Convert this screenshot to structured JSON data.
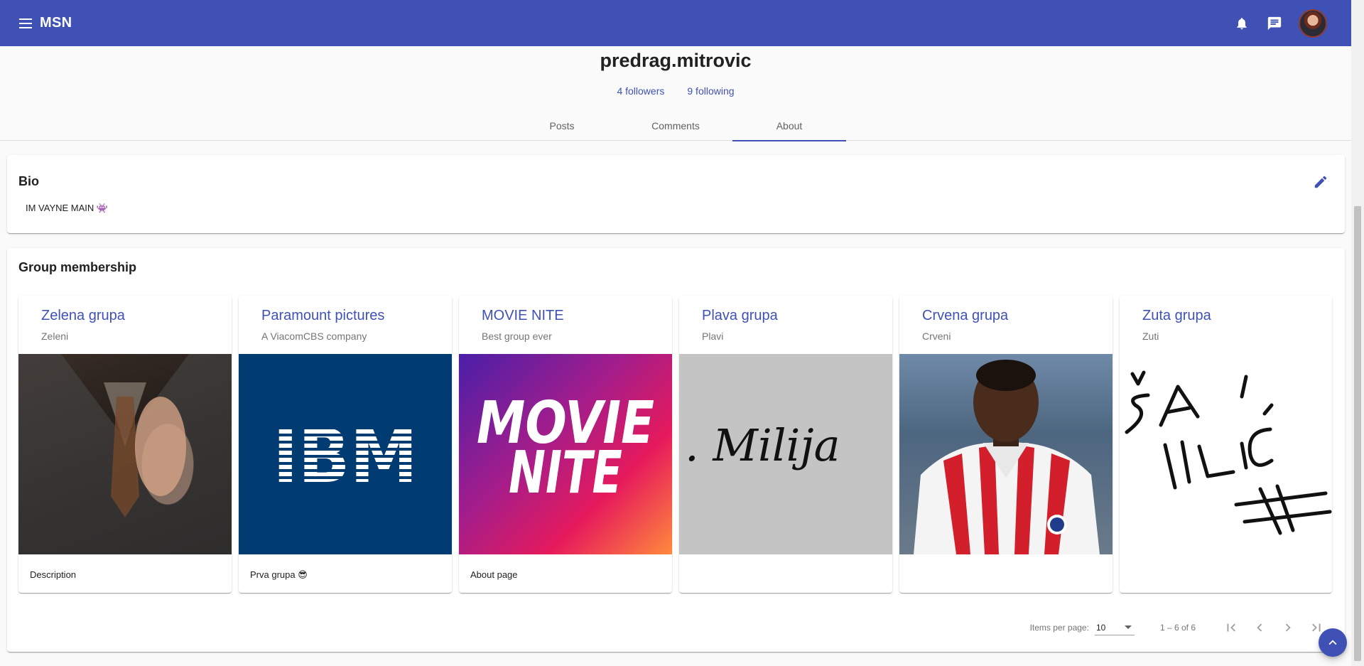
{
  "app": {
    "title": "MSN"
  },
  "toolbar": {
    "icons": [
      "menu-icon",
      "bell-icon",
      "chat-icon"
    ],
    "color": "#3f51b5"
  },
  "profile": {
    "username": "predrag.mitrovic",
    "followers": "4 followers",
    "following": "9 following"
  },
  "tabs": [
    {
      "label": "Posts"
    },
    {
      "label": "Comments"
    },
    {
      "label": "About",
      "active": true
    }
  ],
  "bio": {
    "title": "Bio",
    "text": "IM VAYNE MAIN 👾"
  },
  "groups": {
    "title": "Group membership",
    "items": [
      {
        "name": "Zelena grupa",
        "subtitle": "Zeleni",
        "description": "Description",
        "image": "suit-photo"
      },
      {
        "name": "Paramount pictures",
        "subtitle": "A ViacomCBS company",
        "description": "Prva grupa 😎",
        "image": "ibm-logo",
        "image_text": "IBM"
      },
      {
        "name": "MOVIE NITE",
        "subtitle": "Best group ever",
        "description": "About page",
        "image": "movie-nite-poster",
        "image_text": "MOVIE NITE"
      },
      {
        "name": "Plava grupa",
        "subtitle": "Plavi",
        "description": "",
        "image": "signature-image",
        "image_text": ". Milija"
      },
      {
        "name": "Crvena grupa",
        "subtitle": "Crveni",
        "description": "",
        "image": "football-player-photo"
      },
      {
        "name": "Zuta grupa",
        "subtitle": "Zuti",
        "description": "",
        "image": "handwriting-image",
        "image_text": "ŠA ILIĆ #"
      }
    ]
  },
  "paginator": {
    "items_per_page_label": "Items per page:",
    "items_per_page_value": "10",
    "range": "1 – 6 of 6"
  }
}
